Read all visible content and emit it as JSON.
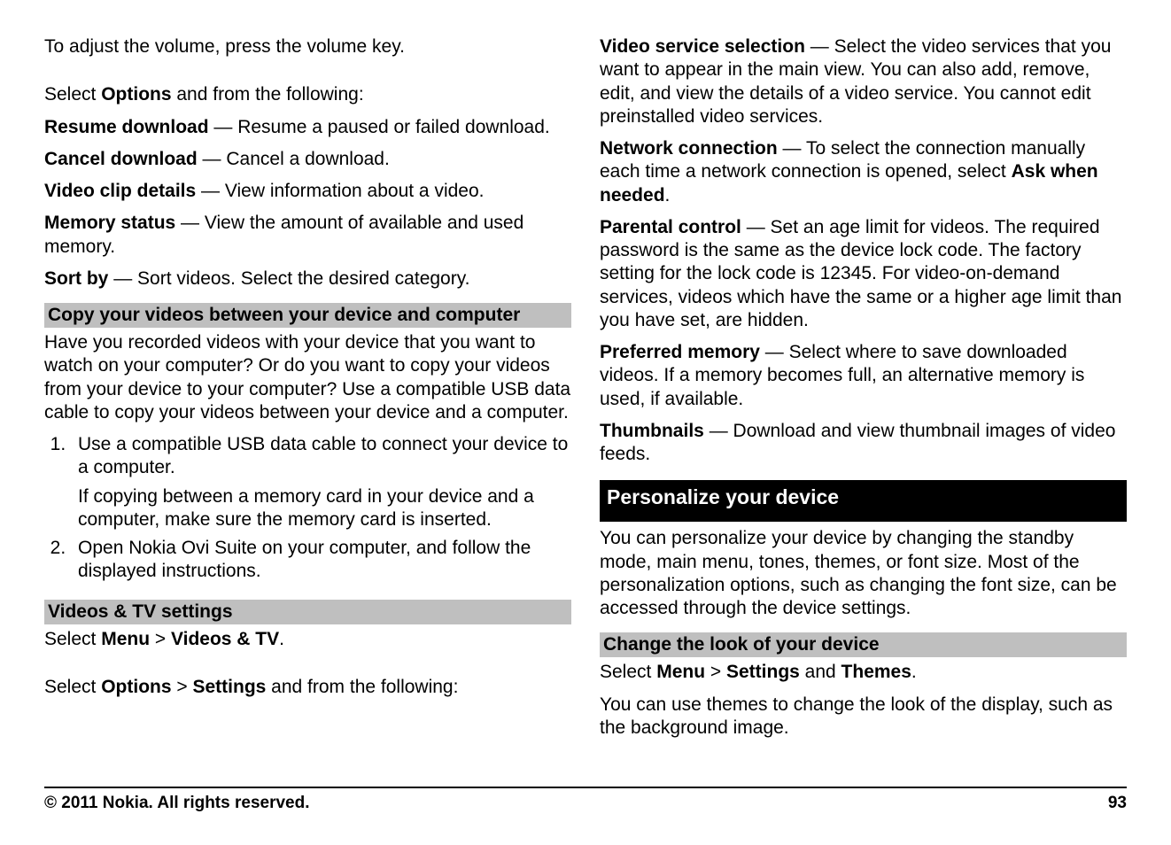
{
  "left": {
    "p1": "To adjust the volume, press the volume key.",
    "p2_pre": "Select ",
    "p2_b": "Options",
    "p2_post": " and from the following:",
    "opt1_b": "Resume download ",
    "opt1_t": " — Resume a paused or failed download.",
    "opt2_b": "Cancel download ",
    "opt2_t": " — Cancel a download.",
    "opt3_b": "Video clip details ",
    "opt3_t": " — View information about a video.",
    "opt4_b": "Memory status ",
    "opt4_t": " — View the amount of available and used memory.",
    "opt5_b": "Sort by ",
    "opt5_t": " — Sort videos. Select the desired category.",
    "sub1": "Copy your videos between your device and computer",
    "p3": "Have you recorded videos with your device that you want to watch on your computer? Or do you want to copy your videos from your device to your computer? Use a compatible USB data cable to copy your videos between your device and a computer.",
    "step1a": "Use a compatible USB data cable to connect your device to a computer.",
    "step1b": "If copying between a memory card in your device and a computer, make sure the memory card is inserted.",
    "step2": "Open Nokia Ovi Suite on your computer, and follow the displayed instructions.",
    "sub2": "Videos & TV settings",
    "p4_pre": "Select ",
    "p4_b1": "Menu ",
    "p4_mid": " > ",
    "p4_b2": "Videos & TV",
    "p4_post": ".",
    "p5_pre": "Select ",
    "p5_b1": "Options ",
    "p5_mid": " > ",
    "p5_b2": "Settings",
    "p5_post": " and from the following:"
  },
  "right": {
    "r1_b": "Video service selection ",
    "r1_t": " — Select the video services that you want to appear in the main view. You can also add, remove, edit, and view the details of a video service. You cannot edit preinstalled video services.",
    "r2_b": "Network connection ",
    "r2_t1": " — To select the connection manually each time a network connection is opened, select ",
    "r2_b2": "Ask when needed",
    "r2_t2": ".",
    "r3_b": "Parental control ",
    "r3_t": " — Set an age limit for videos. The required password is the same as the device lock code. The factory setting for the lock code is 12345. For video-on-demand services, videos which have the same or a higher age limit than you have set, are hidden.",
    "r4_b": "Preferred memory ",
    "r4_t": " — Select where to save downloaded videos. If a memory becomes full, an alternative memory is used, if available.",
    "r5_b": "Thumbnails ",
    "r5_t": " — Download and view thumbnail images of video feeds.",
    "main1": "Personalize your device",
    "p6": "You can personalize your device by changing the standby mode, main menu, tones, themes, or font size. Most of the personalization options, such as changing the font size, can be accessed through the device settings.",
    "sub3": "Change the look of your device",
    "p7_pre": "Select ",
    "p7_b1": "Menu ",
    "p7_mid1": " > ",
    "p7_b2": "Settings",
    "p7_mid2": " and ",
    "p7_b3": "Themes",
    "p7_post": ".",
    "p8": "You can use themes to change the look of the display, such as the background image."
  },
  "footer": {
    "left": "© 2011 Nokia. All rights reserved.",
    "right": "93"
  }
}
